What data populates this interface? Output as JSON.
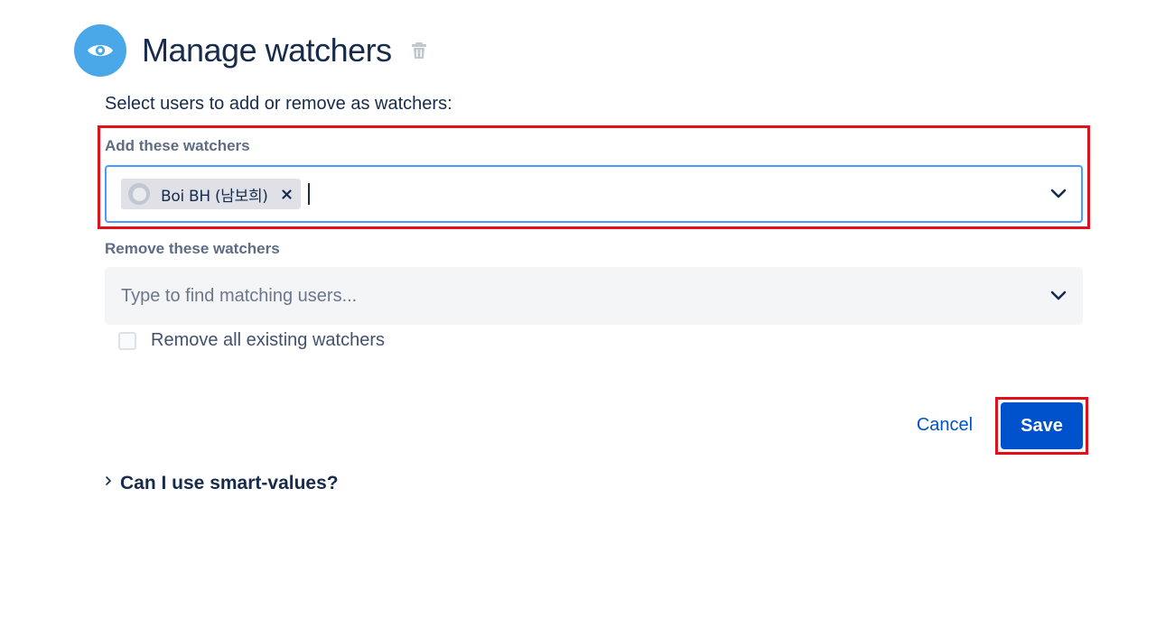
{
  "header": {
    "title": "Manage watchers",
    "icon": "eye-icon",
    "delete_icon": "trash-icon",
    "icon_badge_color": "#4aa8e8"
  },
  "form": {
    "intro": "Select users to add or remove as watchers:",
    "add_section": {
      "label": "Add these watchers",
      "selected_users": [
        {
          "name": "Boi BH (남보희)"
        }
      ]
    },
    "remove_section": {
      "label": "Remove these watchers",
      "placeholder": "Type to find matching users..."
    },
    "remove_all": {
      "label": "Remove all existing watchers",
      "checked": false
    }
  },
  "actions": {
    "cancel_label": "Cancel",
    "save_label": "Save",
    "primary_color": "#0052cc"
  },
  "faq": {
    "label": "Can I use smart-values?"
  },
  "annotations": {
    "highlight_color": "#e0111a"
  }
}
